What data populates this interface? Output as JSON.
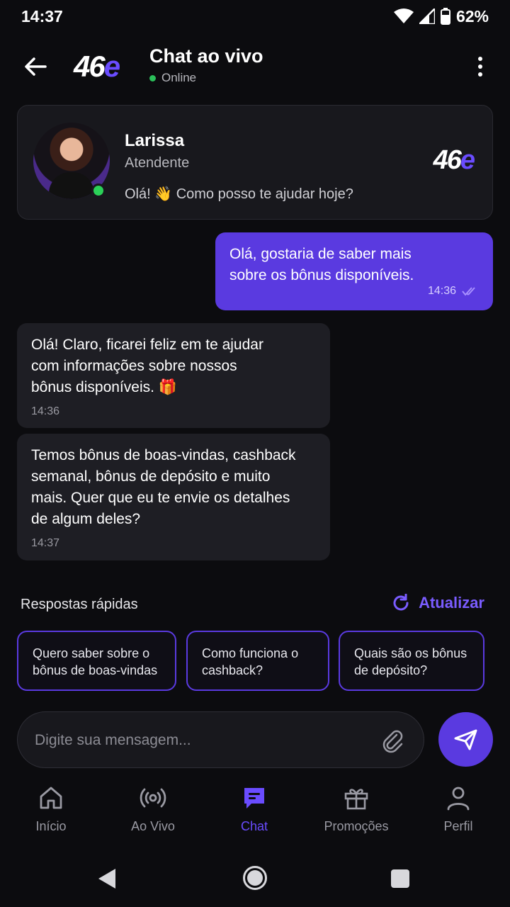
{
  "status_bar": {
    "time": "14:37",
    "battery": "62%"
  },
  "header": {
    "logo_num": "46",
    "logo_e": "e",
    "title": "Chat ao vivo",
    "status": "Online"
  },
  "agent": {
    "name": "Larissa",
    "role": "Atendente",
    "greeting": "Olá! 👋 Como posso te ajudar hoje?"
  },
  "messages": [
    {
      "direction": "out",
      "text": "Olá, gostaria de saber mais\nsobre os bônus disponíveis.",
      "time": "14:36"
    },
    {
      "direction": "in",
      "text": "Olá! Claro, ficarei feliz em te ajudar\ncom informações sobre nossos\nbônus disponíveis. 🎁",
      "time": "14:36"
    },
    {
      "direction": "in",
      "text": "Temos bônus de boas-vindas, cashback\nsemanal, bônus de depósito e muito\nmais. Quer que eu te envie os detalhes\nde algum deles?",
      "time": "14:37"
    }
  ],
  "quick_replies": {
    "title": "Respostas rápidas",
    "refresh_label": "Atualizar",
    "items": [
      "Quero saber sobre o\nbônus de boas-vindas",
      "Como funciona o\ncashback?",
      "Quais são os bônus\nde depósito?"
    ]
  },
  "composer": {
    "placeholder": "Digite sua mensagem..."
  },
  "bottom_nav": [
    {
      "label": "Início",
      "icon": "home-icon"
    },
    {
      "label": "Ao Vivo",
      "icon": "broadcast-icon"
    },
    {
      "label": "Chat",
      "icon": "chat-icon",
      "active": true
    },
    {
      "label": "Promoções",
      "icon": "gift-icon"
    },
    {
      "label": "Perfil",
      "icon": "user-icon"
    }
  ],
  "colors": {
    "accent": "#5a3ae0",
    "background": "#0c0c0f",
    "online": "#2bbf5a"
  }
}
